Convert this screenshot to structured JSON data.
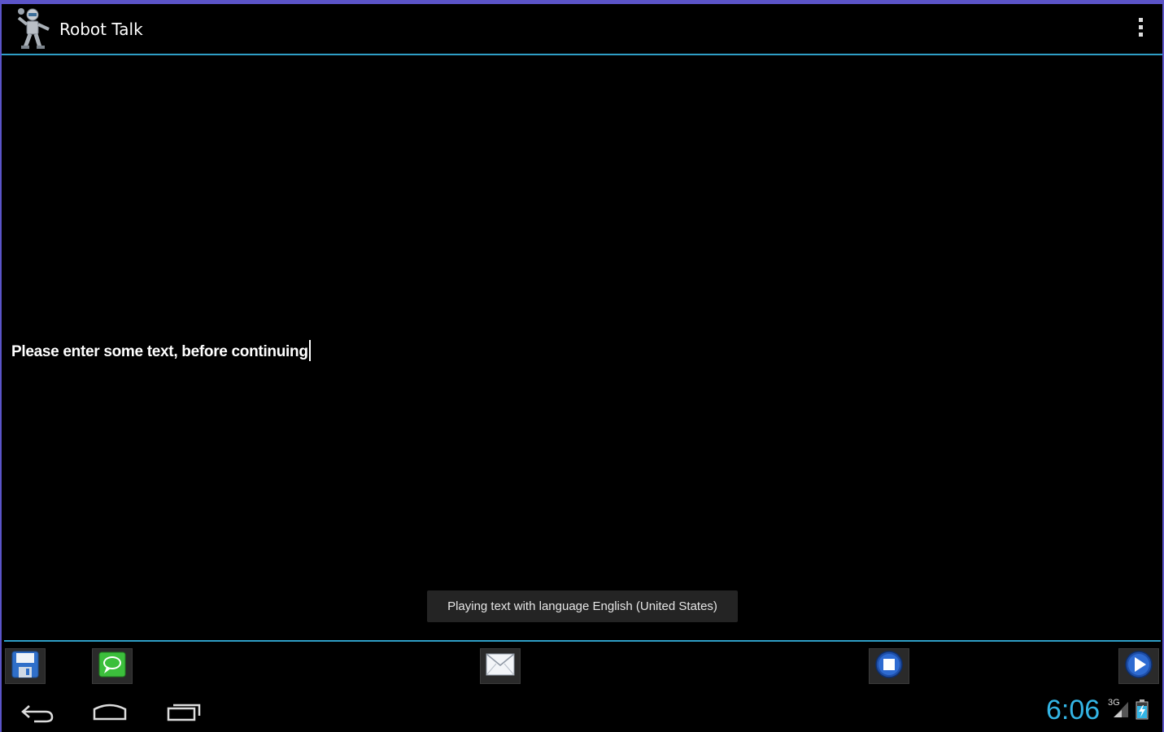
{
  "app": {
    "title": "Robot Talk"
  },
  "editor": {
    "text": "Please enter some text, before continuing"
  },
  "toast": {
    "message": "Playing text with language English (United States)"
  },
  "toolbar": {
    "buttons": [
      {
        "name": "save",
        "icon": "floppy-disk-icon"
      },
      {
        "name": "sms",
        "icon": "speech-bubble-icon"
      },
      {
        "name": "email",
        "icon": "envelope-icon"
      },
      {
        "name": "stop",
        "icon": "stop-icon"
      },
      {
        "name": "play",
        "icon": "play-icon"
      }
    ]
  },
  "status_bar": {
    "time": "6:06",
    "network": "3G"
  },
  "colors": {
    "accent": "#33b5e5",
    "divider": "#2e9ec6",
    "frame": "#5b54c8",
    "background": "#000000"
  }
}
